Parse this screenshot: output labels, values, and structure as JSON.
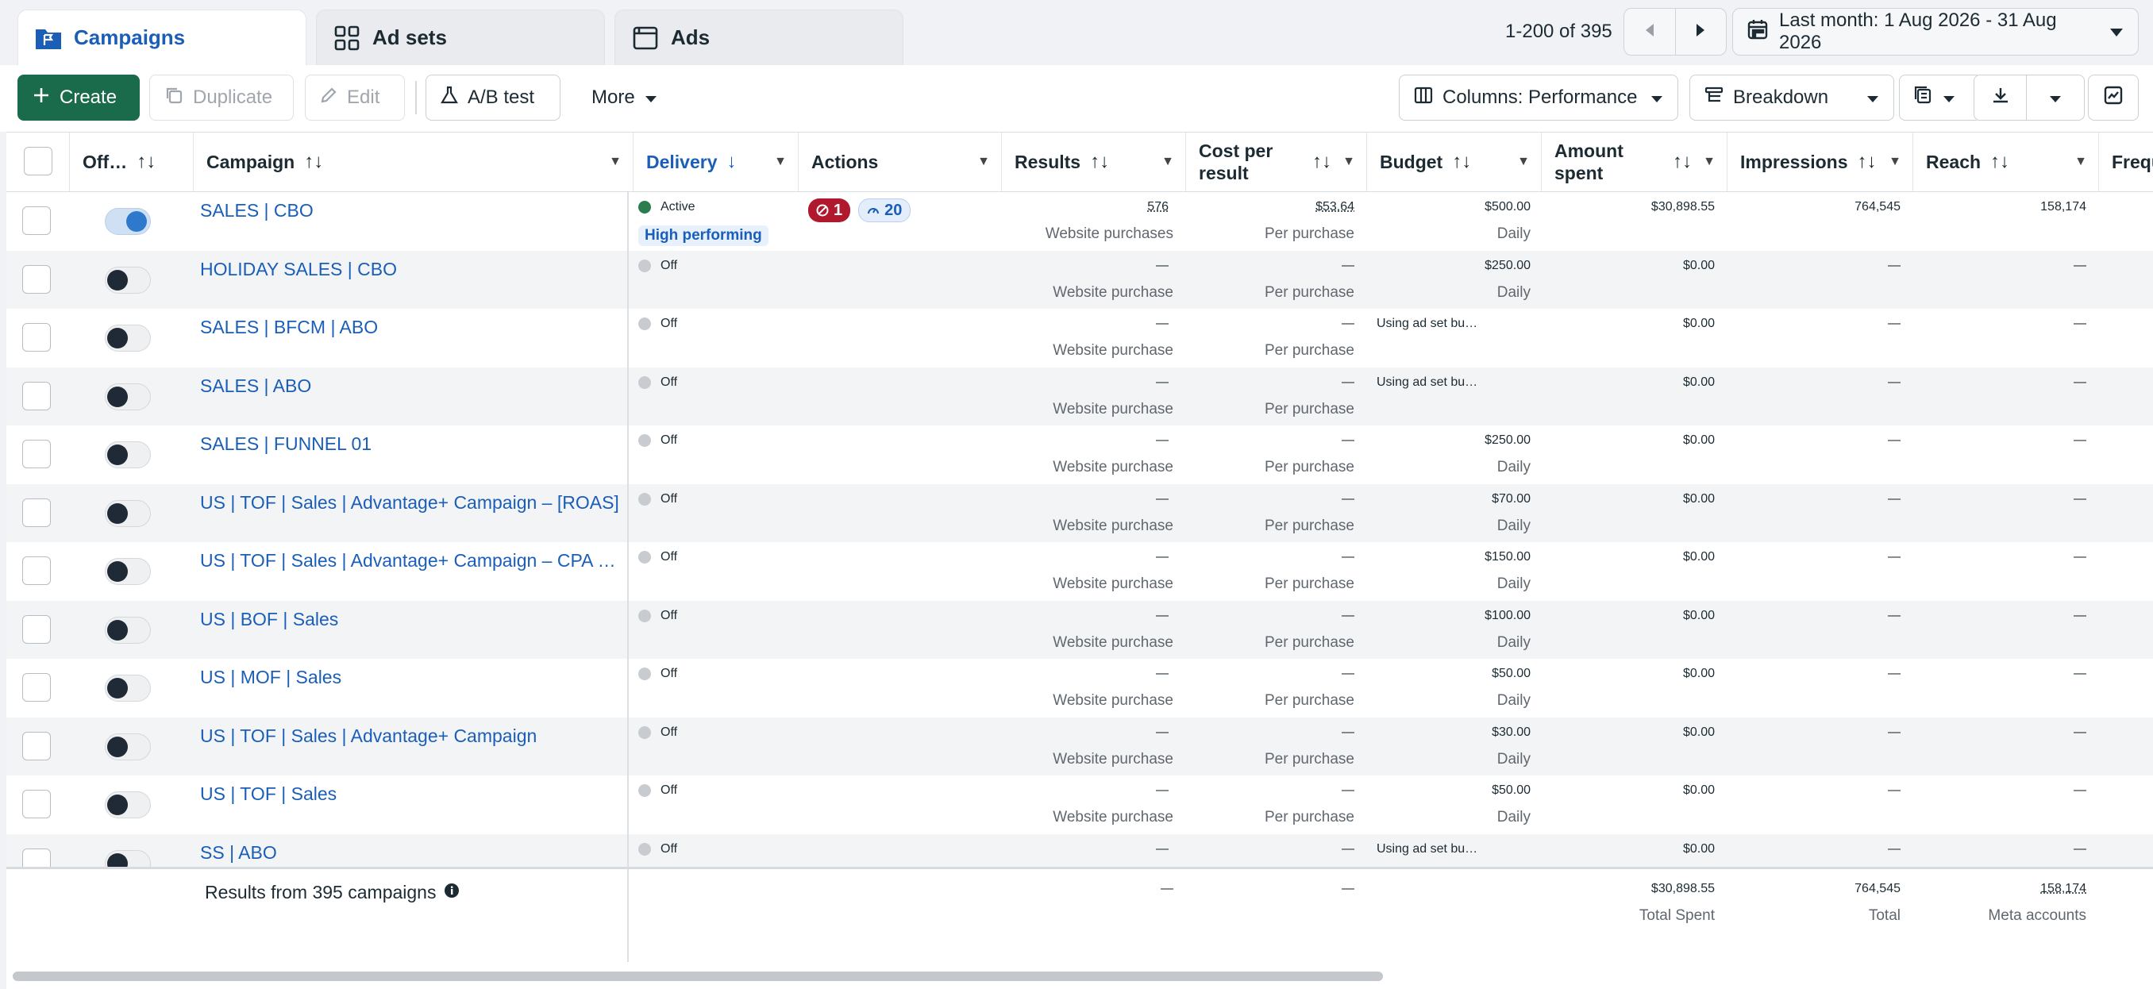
{
  "tabs": [
    {
      "label": "Campaigns",
      "icon": "folder-flag-icon",
      "active": true
    },
    {
      "label": "Ad sets",
      "icon": "grid-icon",
      "active": false
    },
    {
      "label": "Ads",
      "icon": "ad-window-icon",
      "active": false
    }
  ],
  "pager": {
    "text": "1-200 of 395"
  },
  "date_range": {
    "label": "Last month: 1 Aug 2026 - 31 Aug 2026"
  },
  "toolbar": {
    "create": "Create",
    "duplicate": "Duplicate",
    "edit": "Edit",
    "ab_test": "A/B test",
    "more": "More",
    "columns": "Columns: Performance",
    "breakdown": "Breakdown"
  },
  "headers": {
    "offon": "Off…",
    "campaign": "Campaign",
    "delivery": "Delivery",
    "actions": "Actions",
    "results": "Results",
    "cost_per_result_1": "Cost per",
    "cost_per_result_2": "result",
    "budget": "Budget",
    "amount_spent_1": "Amount",
    "amount_spent_2": "spent",
    "impressions": "Impressions",
    "reach": "Reach",
    "frequency": "Frequ"
  },
  "rows": [
    {
      "name": "SALES | CBO",
      "on": true,
      "delivery": "Active",
      "badge": "High performing",
      "issues": "1",
      "opps": "20",
      "results": "576",
      "results_sub": "Website purchases",
      "cpr": "$53.64",
      "cpr_sub": "Per purchase",
      "budget": "$500.00",
      "budget_sub": "Daily",
      "spent": "$30,898.55",
      "impressions": "764,545",
      "reach": "158,174"
    },
    {
      "name": "HOLIDAY SALES | CBO",
      "on": false,
      "delivery": "Off",
      "results": "—",
      "results_sub": "Website purchase",
      "cpr": "—",
      "cpr_sub": "Per purchase",
      "budget": "$250.00",
      "budget_sub": "Daily",
      "spent": "$0.00",
      "impressions": "—",
      "reach": "—"
    },
    {
      "name": "SALES | BFCM | ABO",
      "on": false,
      "delivery": "Off",
      "results": "—",
      "results_sub": "Website purchase",
      "cpr": "—",
      "cpr_sub": "Per purchase",
      "budget_text": "Using ad set bu…",
      "spent": "$0.00",
      "impressions": "—",
      "reach": "—"
    },
    {
      "name": "SALES | ABO",
      "on": false,
      "delivery": "Off",
      "results": "—",
      "results_sub": "Website purchase",
      "cpr": "—",
      "cpr_sub": "Per purchase",
      "budget_text": "Using ad set bu…",
      "spent": "$0.00",
      "impressions": "—",
      "reach": "—"
    },
    {
      "name": "SALES | FUNNEL 01",
      "on": false,
      "delivery": "Off",
      "results": "—",
      "results_sub": "Website purchase",
      "cpr": "—",
      "cpr_sub": "Per purchase",
      "budget": "$250.00",
      "budget_sub": "Daily",
      "spent": "$0.00",
      "impressions": "—",
      "reach": "—"
    },
    {
      "name": "US | TOF | Sales | Advantage+ Campaign – [ROAS]",
      "on": false,
      "delivery": "Off",
      "results": "—",
      "results_sub": "Website purchase",
      "cpr": "—",
      "cpr_sub": "Per purchase",
      "budget": "$70.00",
      "budget_sub": "Daily",
      "spent": "$0.00",
      "impressions": "—",
      "reach": "—"
    },
    {
      "name": "US | TOF | Sales | Advantage+ Campaign – CPA C…",
      "on": false,
      "delivery": "Off",
      "results": "—",
      "results_sub": "Website purchase",
      "cpr": "—",
      "cpr_sub": "Per purchase",
      "budget": "$150.00",
      "budget_sub": "Daily",
      "spent": "$0.00",
      "impressions": "—",
      "reach": "—"
    },
    {
      "name": "US | BOF | Sales",
      "on": false,
      "delivery": "Off",
      "results": "—",
      "results_sub": "Website purchase",
      "cpr": "—",
      "cpr_sub": "Per purchase",
      "budget": "$100.00",
      "budget_sub": "Daily",
      "spent": "$0.00",
      "impressions": "—",
      "reach": "—"
    },
    {
      "name": "US | MOF | Sales",
      "on": false,
      "delivery": "Off",
      "results": "—",
      "results_sub": "Website purchase",
      "cpr": "—",
      "cpr_sub": "Per purchase",
      "budget": "$50.00",
      "budget_sub": "Daily",
      "spent": "$0.00",
      "impressions": "—",
      "reach": "—"
    },
    {
      "name": "US | TOF | Sales | Advantage+ Campaign",
      "on": false,
      "delivery": "Off",
      "results": "—",
      "results_sub": "Website purchase",
      "cpr": "—",
      "cpr_sub": "Per purchase",
      "budget": "$30.00",
      "budget_sub": "Daily",
      "spent": "$0.00",
      "impressions": "—",
      "reach": "—"
    },
    {
      "name": "US | TOF | Sales",
      "on": false,
      "delivery": "Off",
      "results": "—",
      "results_sub": "Website purchase",
      "cpr": "—",
      "cpr_sub": "Per purchase",
      "budget": "$50.00",
      "budget_sub": "Daily",
      "spent": "$0.00",
      "impressions": "—",
      "reach": "—"
    },
    {
      "name": "SS | ABO",
      "on": false,
      "delivery": "Off",
      "results": "—",
      "results_sub": "",
      "cpr": "—",
      "cpr_sub": "",
      "budget_text": "Using ad set bu…",
      "spent": "$0.00",
      "impressions": "—",
      "reach": "—"
    }
  ],
  "summary": {
    "label": "Results from 395 campaigns",
    "results": "—",
    "cpr": "—",
    "spent": "$30,898.55",
    "spent_sub": "Total Spent",
    "impressions": "764,545",
    "impressions_sub": "Total",
    "reach": "158,174",
    "reach_sub": "Meta accounts"
  }
}
